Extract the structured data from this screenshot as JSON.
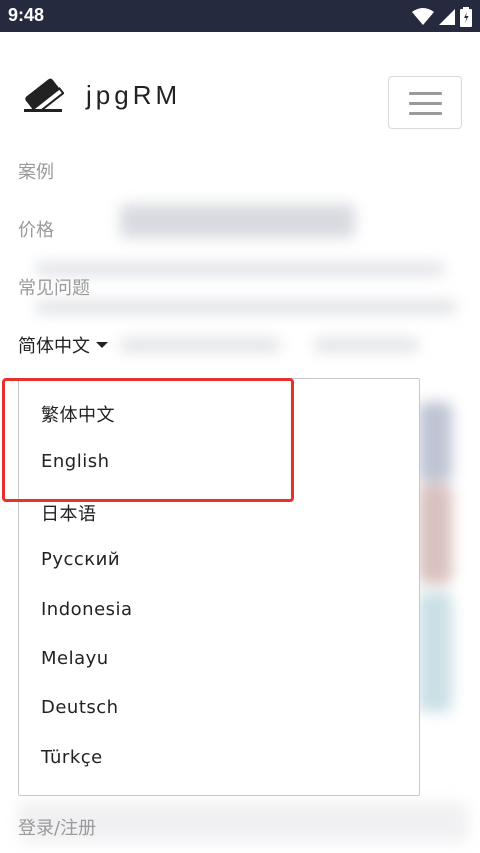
{
  "status_bar": {
    "time": "9:48",
    "icons": [
      "wifi-icon",
      "signal-icon",
      "battery-icon"
    ]
  },
  "brand": {
    "icon": "eraser-icon",
    "name": "jpgRM"
  },
  "nav": {
    "menu_icon": "hamburger-menu-icon",
    "items": [
      {
        "label": "案例"
      },
      {
        "label": "价格"
      },
      {
        "label": "常见问题"
      }
    ],
    "language_toggle": "简体中文",
    "login": "登录/注册"
  },
  "language_menu": {
    "options": [
      {
        "label": "繁体中文"
      },
      {
        "label": "English"
      },
      {
        "label": "日本语"
      },
      {
        "label": "Русский"
      },
      {
        "label": "Indonesia"
      },
      {
        "label": "Melayu"
      },
      {
        "label": "Deutsch"
      },
      {
        "label": "Türkçe"
      }
    ]
  },
  "colors": {
    "status_bar": "#262a3f",
    "highlight": "#e8312a",
    "muted_text": "#9a9a9a"
  }
}
